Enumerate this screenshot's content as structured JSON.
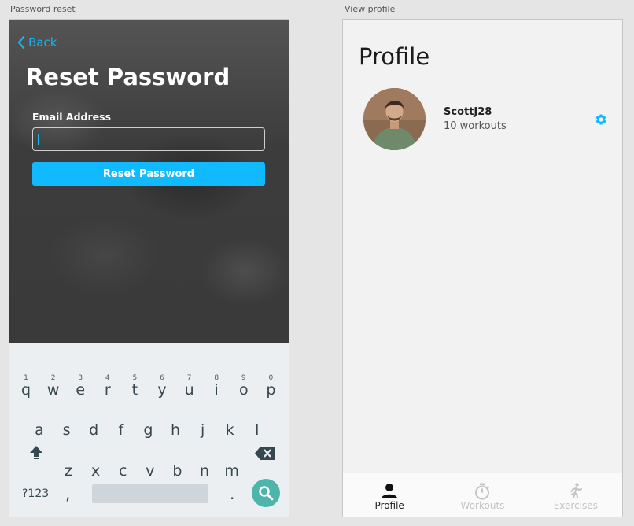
{
  "artboards": {
    "left_label": "Password reset",
    "right_label": "View profile"
  },
  "reset": {
    "back_label": "Back",
    "title": "Reset Password",
    "email_label": "Email Address",
    "email_value": "",
    "button_label": "Reset Password"
  },
  "keyboard": {
    "row1": [
      {
        "ch": "q",
        "num": "1"
      },
      {
        "ch": "w",
        "num": "2"
      },
      {
        "ch": "e",
        "num": "3"
      },
      {
        "ch": "r",
        "num": "4"
      },
      {
        "ch": "t",
        "num": "5"
      },
      {
        "ch": "y",
        "num": "6"
      },
      {
        "ch": "u",
        "num": "7"
      },
      {
        "ch": "i",
        "num": "8"
      },
      {
        "ch": "o",
        "num": "9"
      },
      {
        "ch": "p",
        "num": "0"
      }
    ],
    "row2": [
      "a",
      "s",
      "d",
      "f",
      "g",
      "h",
      "j",
      "k",
      "l"
    ],
    "row3": [
      "z",
      "x",
      "c",
      "v",
      "b",
      "n",
      "m"
    ],
    "symbols_label": "?123",
    "comma": ",",
    "period": "."
  },
  "profile": {
    "title": "Profile",
    "username": "ScottJ28",
    "workouts_count": "10 workouts"
  },
  "tabs": [
    {
      "label": "Profile",
      "icon": "person-icon",
      "active": true
    },
    {
      "label": "Workouts",
      "icon": "stopwatch-icon",
      "active": false
    },
    {
      "label": "Exercises",
      "icon": "runner-icon",
      "active": false
    }
  ],
  "colors": {
    "accent": "#11baff",
    "search_key": "#4db6ac",
    "keyboard_bg": "#eceff1"
  }
}
